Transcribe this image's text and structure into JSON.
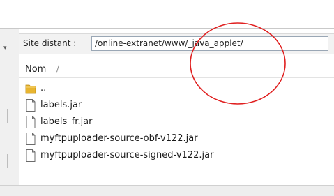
{
  "remote": {
    "site_label": "Site distant :",
    "path": "/online-extranet/www/_java_applet/",
    "column_name": "Nom",
    "sort_indicator": "/",
    "files": [
      {
        "name": "..",
        "icon": "folder-icon"
      },
      {
        "name": "labels.jar",
        "icon": "file-icon"
      },
      {
        "name": "labels_fr.jar",
        "icon": "file-icon"
      },
      {
        "name": "myftpuploader-source-obf-v122.jar",
        "icon": "file-icon"
      },
      {
        "name": "myftpuploader-source-signed-v122.jar",
        "icon": "file-icon"
      }
    ]
  },
  "colors": {
    "annotation_circle": "#e02020",
    "folder": "#e8b530"
  }
}
